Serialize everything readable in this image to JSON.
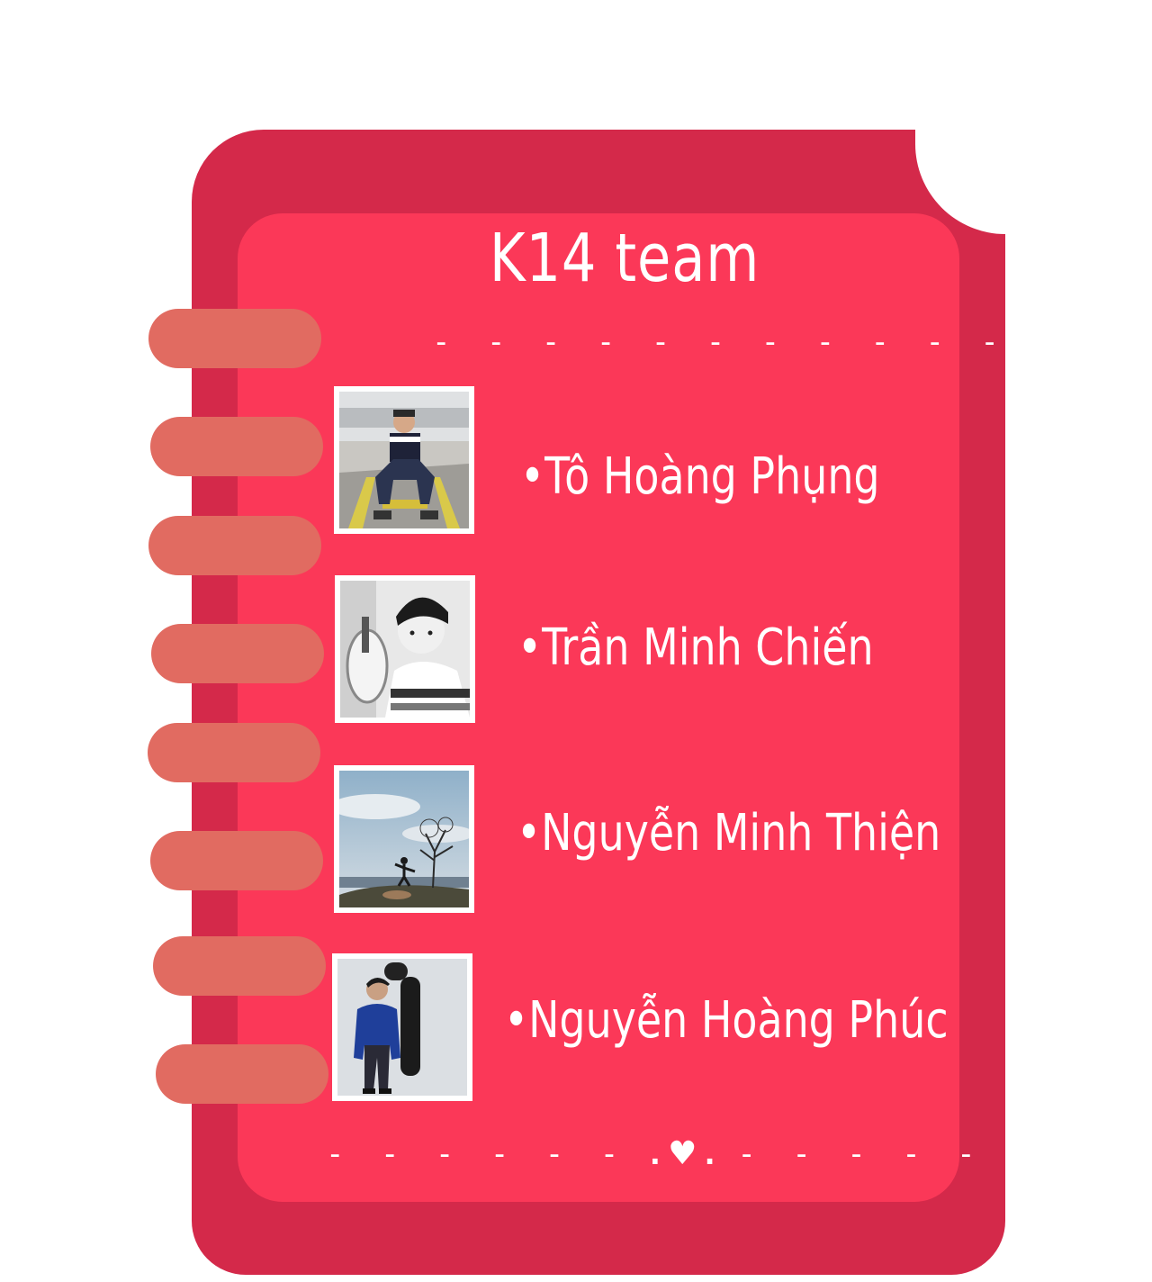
{
  "card": {
    "title": "K14 team",
    "top_divider": "- - - - - - - - - - - -",
    "bottom_divider_left": "- - - - - -",
    "bottom_divider_right": "- - - - - -",
    "heart_symbol": "♥",
    "dot_symbol": "."
  },
  "members": [
    {
      "name": "•Tô Hoàng Phụng",
      "photo_icon": "person-sitting-photo"
    },
    {
      "name": "•Trần Minh Chiến",
      "photo_icon": "person-portrait-bw-photo"
    },
    {
      "name": "•Nguyễn Minh Thiện",
      "photo_icon": "person-hilltop-tree-photo"
    },
    {
      "name": "•Nguyễn Hoàng Phúc",
      "photo_icon": "person-standing-wall-photo"
    }
  ],
  "colors": {
    "cover": "#d4294a",
    "page": "#fb3858",
    "ring": "#e16b61",
    "text": "#ffffff"
  }
}
